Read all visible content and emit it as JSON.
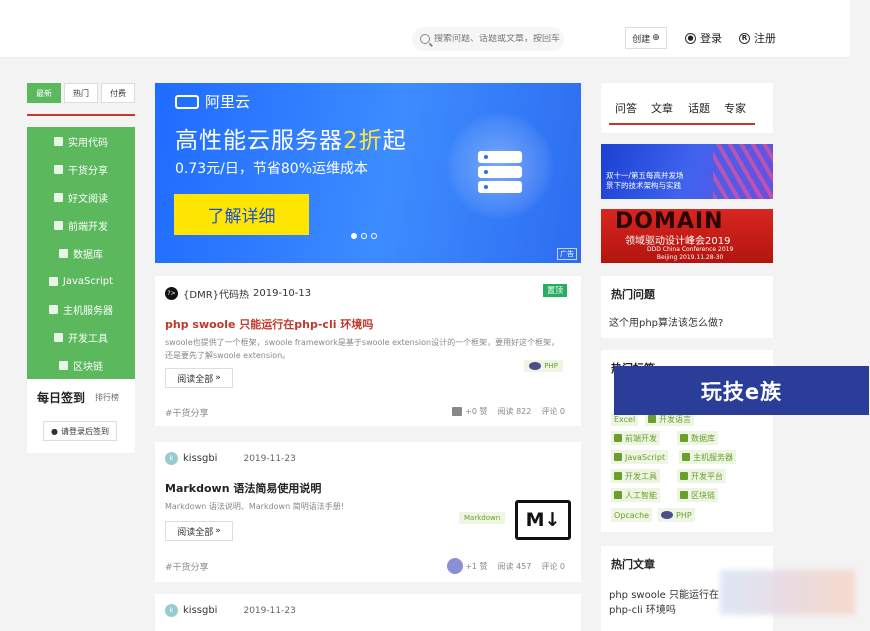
{
  "header": {
    "search_placeholder": "搜索问题、话题或文章，按回车",
    "create_label": "创建",
    "login_label": "登录",
    "register_label": "注册"
  },
  "left": {
    "tabs": [
      "最新",
      "热门",
      "付费"
    ],
    "menu": [
      "实用代码",
      "干货分享",
      "好文阅读",
      "前端开发",
      "数据库",
      "JavaScript",
      "主机服务器",
      "开发工具",
      "区块链"
    ],
    "checkin_title": "每日签到",
    "checkin_rank": "排行榜",
    "checkin_button": "请登录后签到"
  },
  "banner": {
    "brand": "阿里云",
    "headline_pre": "高性能云服务器",
    "headline_hl": "2折",
    "headline_post": "起",
    "sub": "0.73元/日，节省80%运维成本",
    "cta": "了解详细",
    "ad_label": "广告"
  },
  "posts": [
    {
      "author": "{DMR}代码热",
      "date": "2019-10-13",
      "pin": "置顶",
      "title": "php swoole 只能运行在php-cli 环境吗",
      "excerpt": "swoole也提供了一个框架，swoole framework是基于swoole extension设计的一个框架，要用好这个框架，还是要先了解swoole extension。",
      "tag": "PHP",
      "read_more": "阅读全部",
      "category": "#干货分享",
      "likes": "+0 赞",
      "reads": "阅读 822",
      "comments": "评论 0"
    },
    {
      "author": "kissgbi",
      "date": "2019-11-23",
      "title": "Markdown 语法简易使用说明",
      "excerpt": "Markdown 语法说明、Markdown 简明语法手册!",
      "tag": "Markdown",
      "logo_text": "M↓",
      "read_more": "阅读全部",
      "category": "#干货分享",
      "likes": "+1 赞",
      "reads": "阅读 457",
      "comments": "评论 0"
    },
    {
      "author": "kissgbi",
      "date": "2019-11-23"
    }
  ],
  "right": {
    "tabs": [
      "问答",
      "文章",
      "话题",
      "专家"
    ],
    "ad1_text": [
      "双十一/第五每高并发场",
      "景下的技术架构与实践"
    ],
    "ad2_big": "DOMAIN",
    "ad2_line": "领域驱动设计峰会2019",
    "ad2_small": [
      "DDD China Conference 2019",
      "Beijing 2019.11.28-30"
    ],
    "hot_questions_title": "热门问题",
    "hot_question": "这个用php算法该怎么做?",
    "hot_tags_title": "热门标签",
    "tags": [
      "Excel",
      "开发语言",
      "前端开发",
      "数据库",
      "JavaScript",
      "主机服务器",
      "开发工具",
      "开发平台",
      "人工智能",
      "区块链",
      "Opcache",
      "PHP"
    ],
    "hot_articles_title": "热门文章",
    "hot_article": "php swoole 只能运行在php-cli 环境吗"
  },
  "watermark": "玩技e族"
}
